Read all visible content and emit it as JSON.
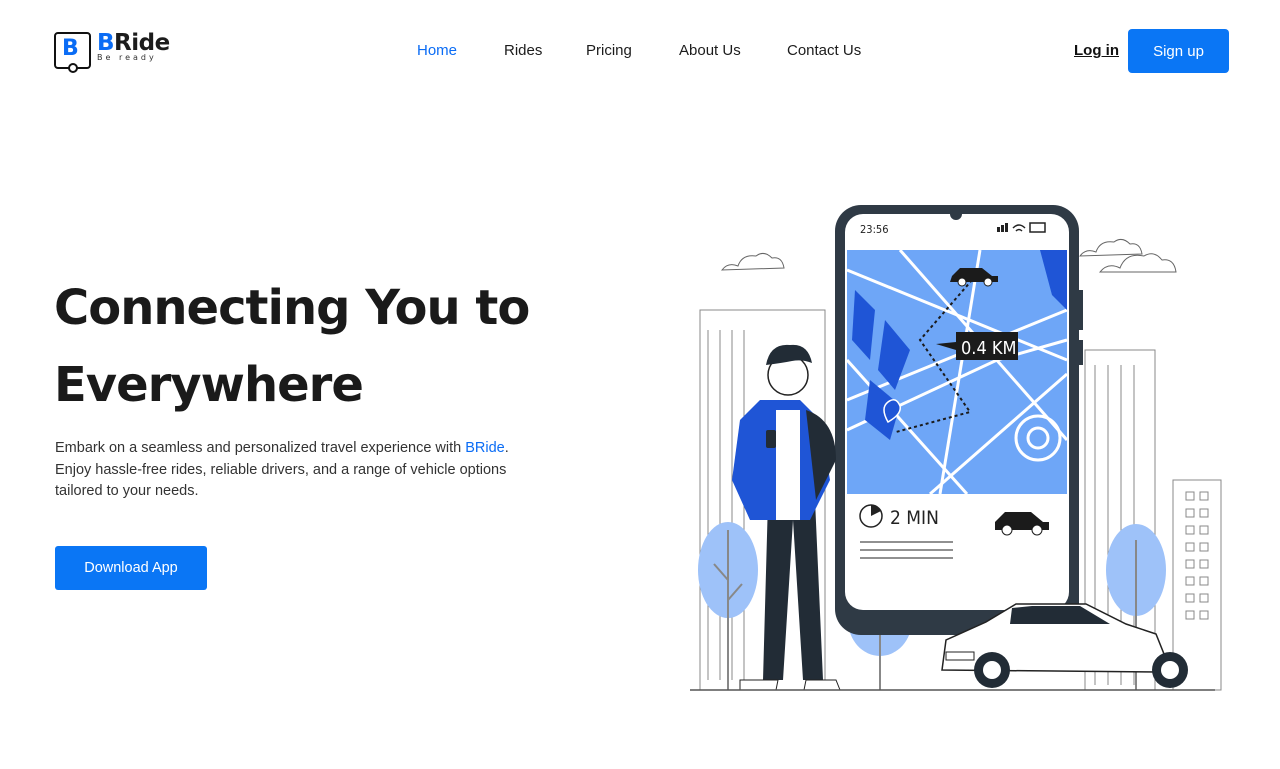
{
  "brand": {
    "letter": "B",
    "name_prefix": "B",
    "name_rest": "Ride",
    "tagline": "Be ready",
    "accent_color": "#0a6cf5"
  },
  "nav": {
    "items": [
      {
        "label": "Home",
        "active": true
      },
      {
        "label": "Rides",
        "active": false
      },
      {
        "label": "Pricing",
        "active": false
      },
      {
        "label": "About Us",
        "active": false
      },
      {
        "label": "Contact Us",
        "active": false
      }
    ],
    "login_label": "Log in",
    "signup_label": "Sign up"
  },
  "hero": {
    "title_line1": "Connecting You to",
    "title_line2": "Everywhere",
    "desc_part1": "Embark on a seamless and personalized travel experience with ",
    "desc_brand": "BRide",
    "desc_part2": ". Enjoy hassle-free rides, reliable drivers, and a range of vehicle options tailored to your needs.",
    "cta_label": "Download App"
  },
  "illustration": {
    "phone_time": "23:56",
    "distance_label": "0.4 KM",
    "eta_label": "2 MIN"
  }
}
